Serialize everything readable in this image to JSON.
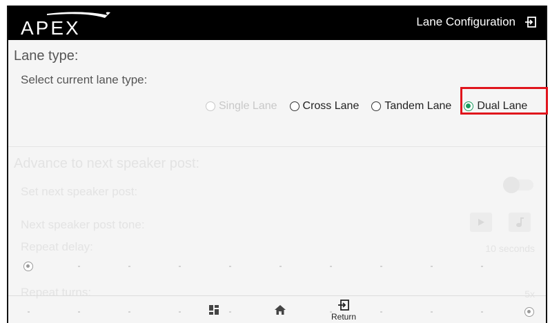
{
  "header": {
    "logo_text": "APEX",
    "title": "Lane Configuration"
  },
  "lane_type": {
    "heading": "Lane type:",
    "select_label": "Select current lane type:",
    "options": [
      {
        "label": "Single Lane",
        "state": "disabled"
      },
      {
        "label": "Cross Lane",
        "state": "unchecked"
      },
      {
        "label": "Tandem Lane",
        "state": "unchecked"
      },
      {
        "label": "Dual Lane",
        "state": "checked"
      }
    ],
    "selected": "Dual Lane"
  },
  "advance": {
    "heading": "Advance to next speaker post:",
    "set_next_label": "Set next speaker post:",
    "set_next_enabled": false,
    "tone_label": "Next speaker post tone:",
    "repeat_delay_label": "Repeat delay:",
    "repeat_delay_value": "10 seconds",
    "repeat_delay_fraction": 0,
    "repeat_turns_label": "Repeat turns:",
    "repeat_turns_value": "5x",
    "repeat_turns_fraction": 1
  },
  "bottom_nav": {
    "return_label": "Return"
  },
  "colors": {
    "accent_green": "#1a9c5e",
    "highlight_red": "#e0141c",
    "topbar": "#000000"
  },
  "icons": [
    "exit-icon",
    "play-icon",
    "music-note-icon",
    "dashboard-icon",
    "home-icon",
    "return-icon"
  ]
}
